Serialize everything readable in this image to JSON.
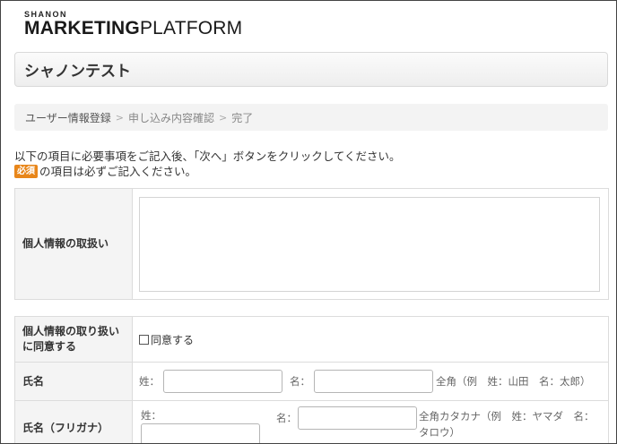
{
  "logo": {
    "top_text": "SHANON",
    "main_bold": "MARKETING",
    "main_light": "PLATFORM"
  },
  "page_title": "シャノンテスト",
  "breadcrumb": {
    "steps": [
      "ユーザー情報登録",
      "申し込み内容確認",
      "完了"
    ],
    "separator": ">"
  },
  "instructions": {
    "line1": "以下の項目に必要事項をご記入後、「次へ」ボタンをクリックしてください。",
    "required_badge": "必須",
    "line2": "の項目は必ずご記入ください。"
  },
  "form": {
    "privacy": {
      "label": "個人情報の取扱い",
      "content": ""
    },
    "consent": {
      "label": "個人情報の取り扱いに同意する",
      "checkbox_label": "同意する",
      "checked": false
    },
    "name": {
      "label": "氏名",
      "last_label": "姓：",
      "first_label": "名：",
      "last_value": "",
      "first_value": "",
      "hint": "全角（例　姓：山田　名：太郎）"
    },
    "name_kana": {
      "label": "氏名（フリガナ）",
      "last_label": "姓：",
      "first_label": "名：",
      "last_value": "",
      "first_value": "",
      "hint": "全角カタカナ（例　姓：ヤマダ　名：タロウ）"
    }
  },
  "colors": {
    "required_badge": "#e8861a",
    "header_bg": "#f4f4f4",
    "border": "#dcdcdc"
  }
}
